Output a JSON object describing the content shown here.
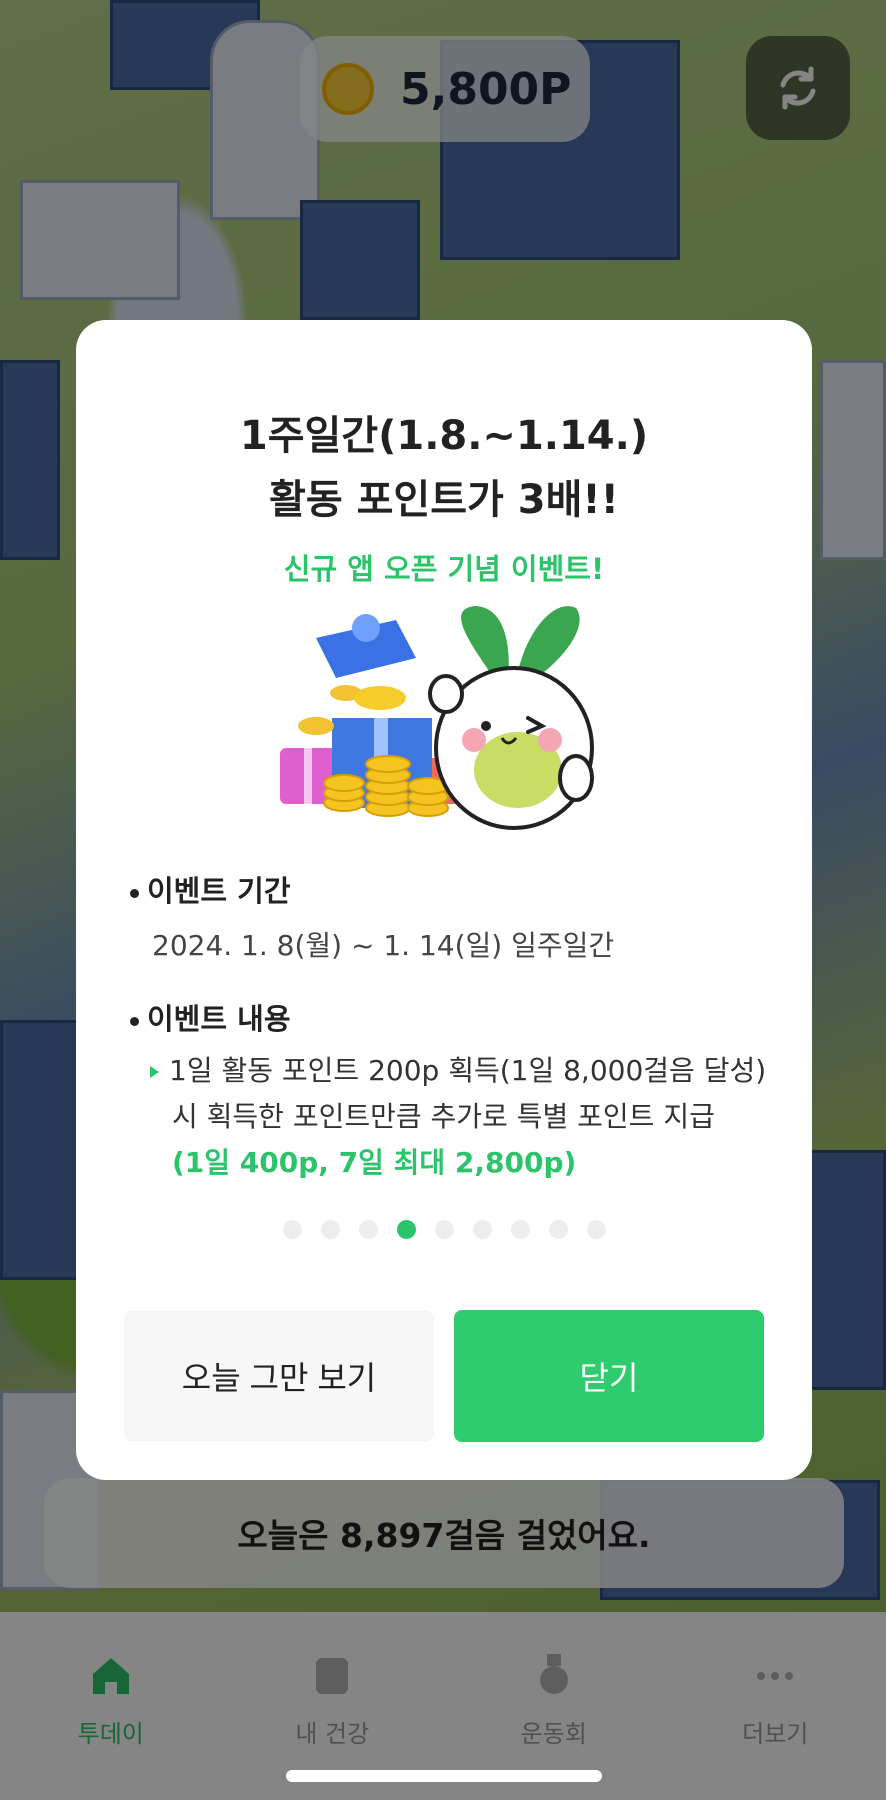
{
  "top_bar": {
    "points": "5,800P",
    "coin_icon": "coin-icon",
    "refresh_icon": "refresh-icon"
  },
  "modal": {
    "title_line1": "1주일간(1.8.~1.14.)",
    "title_line2": "활동 포인트가 3배!!",
    "subtitle": "신규 앱 오픈 기념 이벤트!",
    "period_heading": "이벤트 기간",
    "period_text": "2024. 1. 8(월) ~ 1. 14(일) 일주일간",
    "content_heading": "이벤트 내용",
    "content_line1": "1일 활동 포인트 200p 획득(1일 8,000걸음 달성)",
    "content_line2": "시 획득한 포인트만큼 추가로 특별 포인트 지급",
    "content_highlight": "(1일 400p, 7일 최대 2,800p)",
    "pager": {
      "total": 9,
      "active_index": 3
    },
    "dismiss_today_label": "오늘 그만 보기",
    "close_label": "닫기"
  },
  "steps_banner": "오늘은 8,897걸음 걸었어요.",
  "bottom_nav": {
    "items": [
      {
        "label": "투데이",
        "icon": "home-icon",
        "active": true
      },
      {
        "label": "내 건강",
        "icon": "health-icon",
        "active": false
      },
      {
        "label": "운동회",
        "icon": "medal-icon",
        "active": false
      },
      {
        "label": "더보기",
        "icon": "more-icon",
        "active": false
      }
    ]
  },
  "colors": {
    "accent": "#2ecc6e",
    "accent_text": "#2cc46b",
    "overlay": "rgba(0,0,0,0.48)"
  }
}
